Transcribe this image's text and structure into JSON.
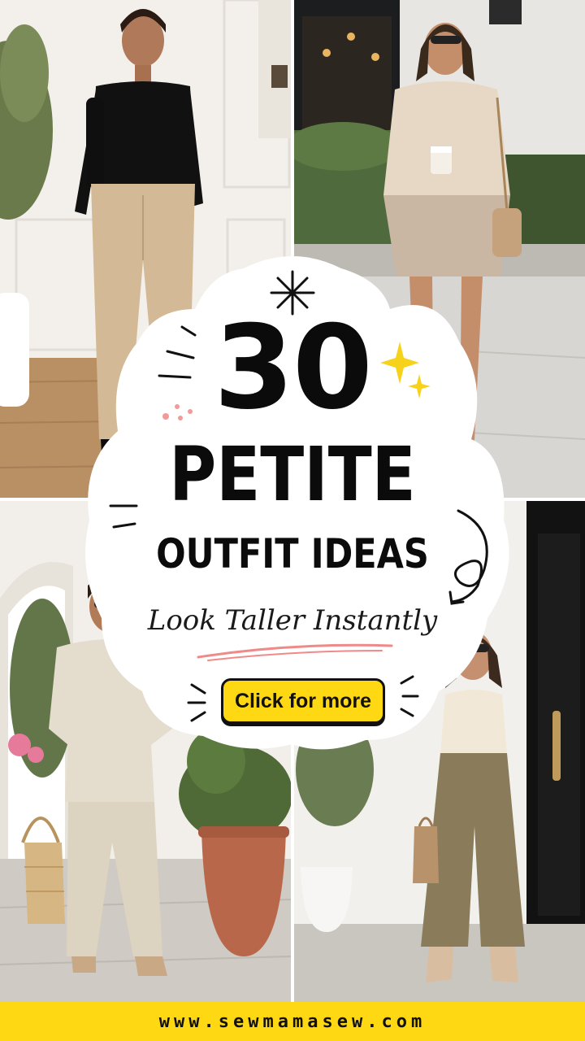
{
  "headline": {
    "number": "30",
    "main": "PETITE",
    "sub": "OUTFIT IDEAS"
  },
  "tagline": "Look Taller Instantly",
  "cta": {
    "label": "Click for more"
  },
  "footer": {
    "url": "www.sewmamasew.com"
  },
  "photos": [
    {
      "id": "photo-black-top-beige-trousers"
    },
    {
      "id": "photo-knit-sweater-mini-skirt"
    },
    {
      "id": "photo-linen-set-straw-bag"
    },
    {
      "id": "photo-tank-top-culottes"
    }
  ],
  "colors": {
    "accent_yellow": "#ffd814",
    "headline_black": "#0b0b0b",
    "underline_pink": "#f08a8a",
    "sparkle_yellow": "#f6d21b",
    "dots_pink": "#f29a9a"
  }
}
